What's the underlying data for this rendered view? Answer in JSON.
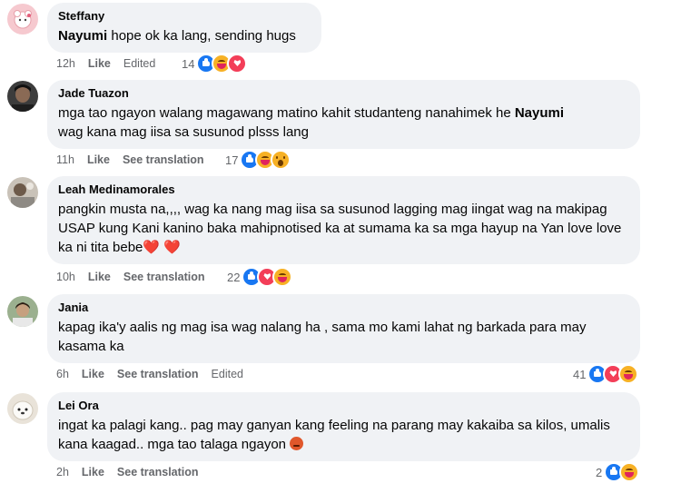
{
  "comments": [
    {
      "name": "Steffany",
      "text_parts": {
        "mention": "Nayumi",
        "rest": " hope ok ka lang, sending hugs"
      },
      "time": "12h",
      "like": "Like",
      "extra": "Edited",
      "react_count": "14",
      "reactions": [
        "like-icon",
        "care-icon",
        "love-icon"
      ]
    },
    {
      "name": "Jade Tuazon",
      "text_parts": {
        "before": "mga tao ngayon walang magawang matino kahit studanteng nanahimek he ",
        "mention": "Nayumi",
        "after": "wag kana mag iisa sa susunod plsss lang"
      },
      "time": "11h",
      "like": "Like",
      "extra": "See translation",
      "react_count": "17",
      "reactions": [
        "like-icon",
        "care-icon",
        "wow-icon"
      ]
    },
    {
      "name": "Leah Medinamorales",
      "text": "pangkin musta na,,,, wag ka nang mag iisa sa susunod lagging mag iingat wag na makipag USAP kung Kani kanino baka mahipnotised ka at sumama ka sa mga hayup na Yan love love ka ni tita bebe",
      "hearts": "❤️ ❤️",
      "time": "10h",
      "like": "Like",
      "extra": "See translation",
      "react_count": "22",
      "reactions": [
        "like-icon",
        "love-icon",
        "care-icon"
      ]
    },
    {
      "name": "Jania",
      "text": "kapag ika'y aalis ng mag isa wag nalang ha , sama mo kami lahat ng barkada para may kasama ka",
      "time": "6h",
      "like": "Like",
      "extra": "See translation",
      "extra2": "Edited",
      "react_count": "41",
      "reactions": [
        "like-icon",
        "love-icon",
        "care-icon"
      ]
    },
    {
      "name": "Lei Ora",
      "text": "ingat ka palagi kang.. pag may ganyan kang feeling na parang may kakaiba sa kilos, umalis kana kaagad.. mga tao talaga ngayon",
      "time": "2h",
      "like": "Like",
      "extra": "See translation",
      "react_count": "2",
      "reactions": [
        "like-icon",
        "care-icon"
      ]
    }
  ]
}
